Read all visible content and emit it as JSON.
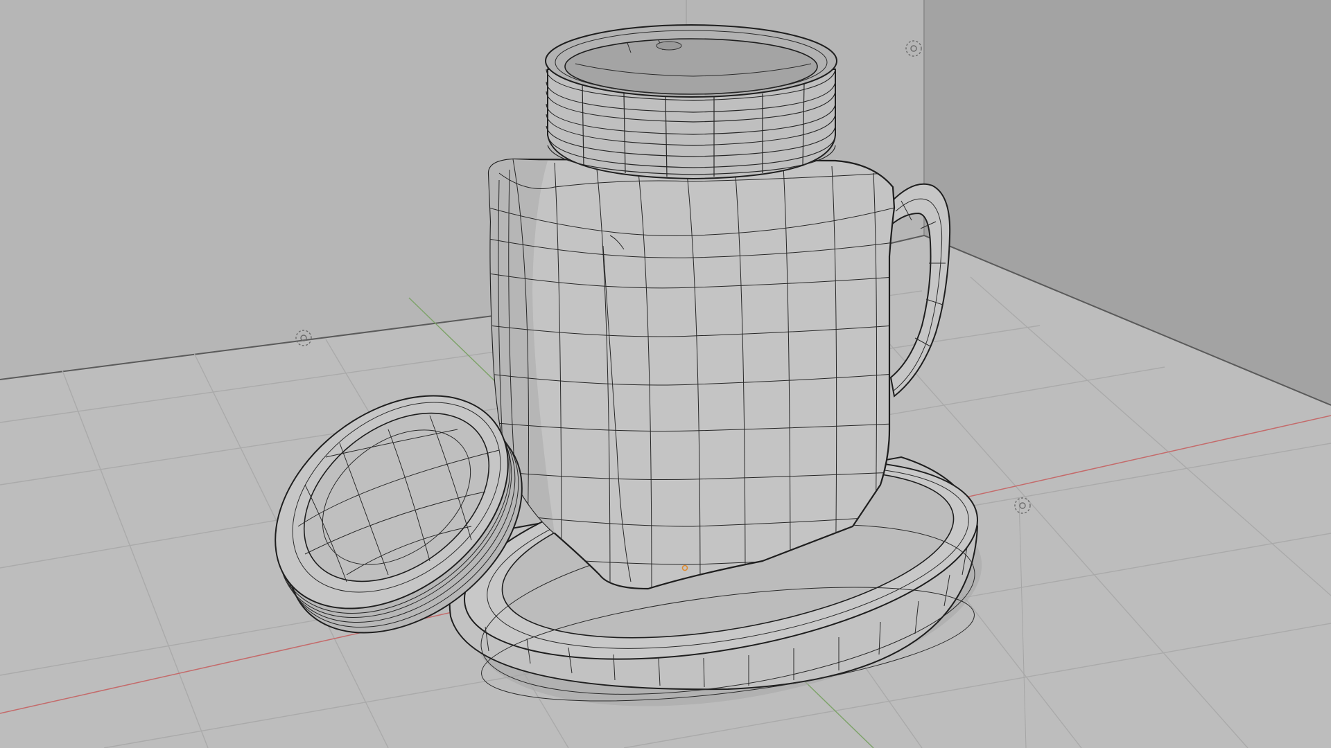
{
  "app": {
    "name": "3D viewport",
    "view_mode": "solid-wireframe-overlay"
  },
  "colors": {
    "wall_left": "#b8b8b8",
    "wall_right": "#a4a4a4",
    "floor": "#bdbdbd",
    "grid_line": "#a9a9a9",
    "axis_x": "#c46a6a",
    "axis_y": "#7ea36a",
    "mesh_fill": "#c4c4c4",
    "mesh_shade": "#b3b3b3",
    "wire": "#1e1e1e",
    "origin_dot": "#e08a2c"
  },
  "scene": {
    "objects": [
      {
        "name": "jar-body",
        "selected": false
      },
      {
        "name": "jar-handle",
        "selected": false
      },
      {
        "name": "jar-neck-thread",
        "selected": false
      },
      {
        "name": "jar-lid",
        "selected": false
      },
      {
        "name": "saucer",
        "selected": false
      }
    ],
    "empties": [
      {
        "name": "empty-a"
      },
      {
        "name": "empty-b"
      },
      {
        "name": "empty-c"
      }
    ],
    "icons": {
      "empty": "dashed-circle-crosshair-icon",
      "origin": "origin-dot-icon"
    }
  }
}
